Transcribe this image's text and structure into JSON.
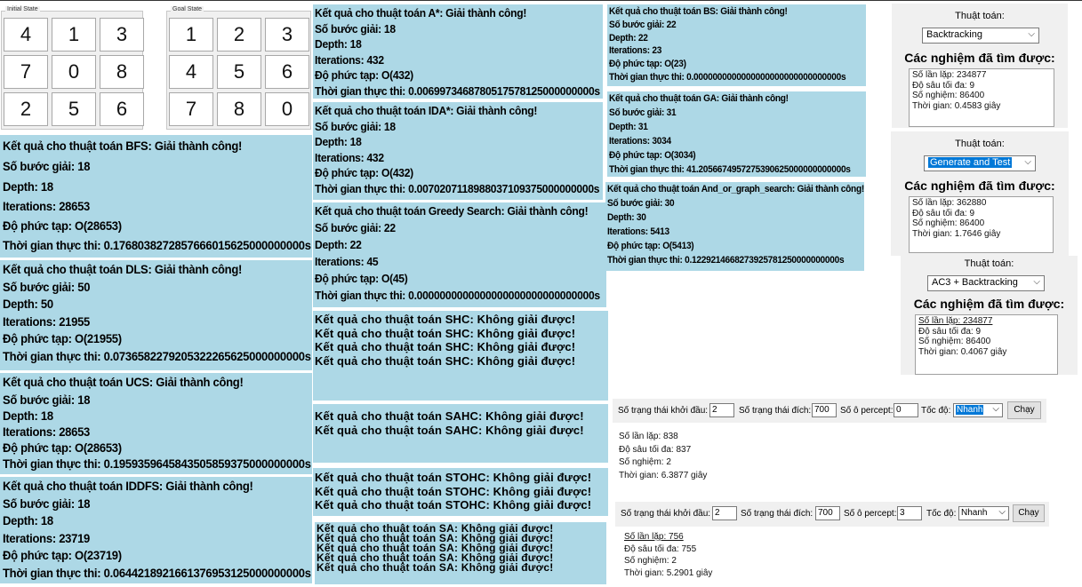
{
  "initial_state": {
    "title": "Initial State",
    "tiles": [
      "4",
      "1",
      "3",
      "7",
      "0",
      "8",
      "2",
      "5",
      "6"
    ]
  },
  "goal_state": {
    "title": "Goal State",
    "tiles": [
      "1",
      "2",
      "3",
      "4",
      "5",
      "6",
      "7",
      "8",
      "0"
    ]
  },
  "bfs": {
    "lines": [
      "Kết quả cho thuật toán BFS: Giải thành công!",
      "Số bước giải: 18",
      "Depth: 18",
      "Iterations: 28653",
      "Độ phức tạp: O(28653)",
      "Thời gian thực thi: 0.1768038272857666015625000000000s"
    ]
  },
  "dls": {
    "lines": [
      "Kết quả cho thuật toán DLS: Giải thành công!",
      "Số bước giải: 50",
      "Depth: 50",
      "Iterations: 21955",
      "Độ phức tạp: O(21955)",
      "Thời gian thực thi: 0.0736582279205322265625000000000s"
    ]
  },
  "ucs": {
    "lines": [
      "Kết quả cho thuật toán UCS: Giải thành công!",
      "Số bước giải: 18",
      "Depth: 18",
      "Iterations: 28653",
      "Độ phức tạp: O(28653)",
      "Thời gian thực thi: 0.1959359645843505859375000000000s"
    ]
  },
  "iddfs": {
    "lines": [
      "Kết quả cho thuật toán IDDFS: Giải thành công!",
      "Số bước giải: 18",
      "Depth: 18",
      "Iterations: 23719",
      "Độ phức tạp: O(23719)",
      "Thời gian thực thi: 0.0644218921661376953125000000000s"
    ]
  },
  "astar": {
    "lines": [
      "Kết quả cho thuật toán A*: Giải thành công!",
      "Số bước giải: 18",
      "Depth: 18",
      "Iterations: 432",
      "Độ phức tạp: O(432)",
      "Thời gian thực thi: 0.0069973468780517578125000000000s"
    ]
  },
  "idastar": {
    "lines": [
      "Kết quả cho thuật toán IDA*: Giải thành công!",
      "Số bước giải: 18",
      "Depth: 18",
      "Iterations: 432",
      "Độ phức tạp: O(432)",
      "Thời gian thực thi: 0.0070207118988037109375000000000s"
    ]
  },
  "greedy": {
    "lines": [
      "Kết quả cho thuật toán Greedy Search: Giải thành công!",
      "Số bước giải: 22",
      "Depth: 22",
      "Iterations: 45",
      "Độ phức tạp: O(45)",
      "Thời gian thực thi: 0.0000000000000000000000000000000s"
    ]
  },
  "shc": {
    "lines": [
      "Kết quả cho thuật toán SHC: Không giải được!",
      "Kết quả cho thuật toán SHC: Không giải được!",
      "Kết quả cho thuật toán SHC: Không giải được!",
      "Kết quả cho thuật toán SHC: Không giải được!"
    ]
  },
  "sahc": {
    "lines": [
      "Kết quả cho thuật toán SAHC: Không giải được!",
      "Kết quả cho thuật toán SAHC: Không giải được!"
    ]
  },
  "stohc": {
    "lines": [
      "Kết quả cho thuật toán STOHC: Không giải được!",
      "Kết quả cho thuật toán STOHC: Không giải được!",
      "Kết quả cho thuật toán STOHC: Không giải được!"
    ]
  },
  "sa": {
    "lines": [
      "Kết quả cho thuật toán SA: Không giải được!",
      "Kết quả cho thuật toán SA: Không giải được!",
      "Kết quả cho thuật toán SA: Không giải được!",
      "Kết quả cho thuật toán SA: Không giải được!",
      "Kết quả cho thuật toán SA: Không giải được!"
    ]
  },
  "bs": {
    "lines": [
      "Kết quả cho thuật toán BS: Giải thành công!",
      "Số bước giải: 22",
      "Depth: 22",
      "Iterations: 23",
      "Độ phức tạp: O(23)",
      "Thời gian thực thi: 0.0000000000000000000000000000000s"
    ]
  },
  "ga": {
    "lines": [
      "Kết quả cho thuật toán GA: Giải thành công!",
      "Số bước giải: 31",
      "Depth: 31",
      "Iterations: 3034",
      "Độ phức tạp: O(3034)",
      "Thời gian thực thi: 41.2056674957275390625000000000000s"
    ]
  },
  "andor": {
    "lines": [
      "Kết quả cho thuật toán And_or_graph_search: Giải thành công!",
      "Số bước giải: 30",
      "Depth: 30",
      "Iterations: 5413",
      "Độ phức tạp: O(5413)",
      "Thời gian thực thi: 0.1229214668273925781250000000000s"
    ]
  },
  "panel1": {
    "label": "Thuật toán:",
    "selected": "Backtracking",
    "heading": "Các nghiệm đã tìm được:",
    "stats": [
      "Số lần lặp: 234877",
      "Độ sâu tối đa: 9",
      "Số nghiệm: 86400",
      "Thời gian: 0.4583 giây"
    ]
  },
  "panel2": {
    "label": "Thuật toán:",
    "selected": "Generate and Test",
    "heading": "Các nghiệm đã tìm được:",
    "stats": [
      "Số lần lặp: 362880",
      "Độ sâu tối đa: 9",
      "Số nghiệm: 86400",
      "Thời gian: 1.7646 giây"
    ]
  },
  "panel3": {
    "label": "Thuật toán:",
    "selected": "AC3 + Backtracking",
    "heading": "Các nghiệm đã tìm được:",
    "stats": [
      "Số lần lặp: 234877",
      "Độ sâu tối đa: 9",
      "Số nghiệm: 86400",
      "Thời gian: 0.4067 giây"
    ]
  },
  "form1": {
    "start_label": "Số trạng thái khởi đầu:",
    "start_value": "2",
    "goal_label": "Số trạng thái đích:",
    "goal_value": "700",
    "percept_label": "Số ô percept:",
    "percept_value": "0",
    "speed_label": "Tốc độ:",
    "speed_value": "Nhanh",
    "run_label": "Chạy",
    "stats": [
      "Số lần lặp: 838",
      "Độ sâu tối đa: 837",
      "Số nghiệm: 2",
      "Thời gian: 6.3877 giây"
    ]
  },
  "form2": {
    "start_label": "Số trạng thái khởi đầu:",
    "start_value": "2",
    "goal_label": "Số trạng thái đích:",
    "goal_value": "700",
    "percept_label": "Số ô percept:",
    "percept_value": "3",
    "speed_label": "Tốc độ:",
    "speed_value": "Nhanh",
    "run_label": "Chạy",
    "stats": [
      "Số lần lặp: 756",
      "Độ sâu tối đa: 755",
      "Số nghiệm: 2",
      "Thời gian: 5.2901 giây"
    ]
  }
}
